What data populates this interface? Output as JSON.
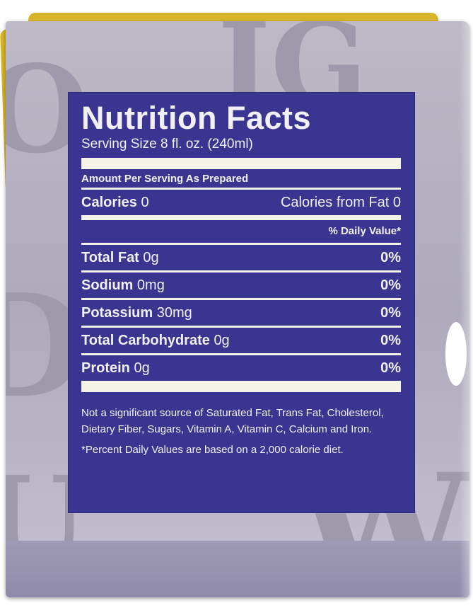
{
  "panel": {
    "title": "Nutrition Facts",
    "serving_size": "Serving Size 8 fl. oz. (240ml)",
    "amount_per_serving": "Amount Per Serving As Prepared",
    "calories_label": "Calories",
    "calories_value": "0",
    "calories_from_fat": "Calories from Fat 0",
    "daily_value_header": "% Daily Value*",
    "nutrients": [
      {
        "name": "Total Fat",
        "amount": "0g",
        "dv": "0%"
      },
      {
        "name": "Sodium",
        "amount": "0mg",
        "dv": "0%"
      },
      {
        "name": "Potassium",
        "amount": "30mg",
        "dv": "0%"
      },
      {
        "name": "Total Carbohydrate",
        "amount": "0g",
        "dv": "0%"
      },
      {
        "name": "Protein",
        "amount": "0g",
        "dv": "0%"
      }
    ],
    "footnote_1": "Not a significant source of Saturated Fat, Trans Fat, Cholesterol, Dietary Fiber, Sugars, Vitamin A, Vitamin C, Calcium and Iron.",
    "footnote_2": "*Percent Daily Values are based on a 2,000 calorie diet."
  },
  "colors": {
    "panel_background": "#3a3591",
    "panel_text": "#f1f0f6",
    "carton": "#b5b1c3",
    "flap": "#d9b324"
  }
}
